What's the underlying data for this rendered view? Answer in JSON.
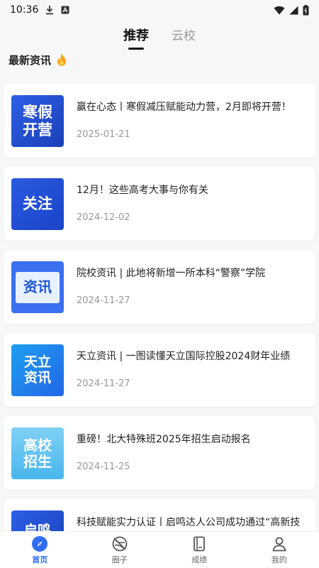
{
  "status": {
    "time": "10:36"
  },
  "tabs": [
    {
      "label": "推荐",
      "active": true
    },
    {
      "label": "云校",
      "active": false
    }
  ],
  "section": {
    "title": "最新资讯",
    "icon": "fire-icon"
  },
  "articles": [
    {
      "thumb_text": "寒假\n开营",
      "title": "赢在心态丨寒假减压赋能动力营，2月即将开营！",
      "date": "2025-01-21"
    },
    {
      "thumb_text": "关注",
      "title": "12月！这些高考大事与你有关",
      "date": "2024-12-02"
    },
    {
      "thumb_text": "资讯",
      "title": "院校资讯 | 此地将新增一所本科“警察”学院",
      "date": "2024-11-27"
    },
    {
      "thumb_text": "天立\n资讯",
      "title": "天立资讯 | 一图读懂天立国际控股2024财年业绩",
      "date": "2024-11-27"
    },
    {
      "thumb_text": "高校\n招生",
      "title": "重磅！北大特殊班2025年招生启动报名",
      "date": "2024-11-25"
    },
    {
      "thumb_text": "启鸣",
      "title": "科技赋能实力认证丨启鸣达人公司成功通过“高新技术企业”认定！",
      "date": ""
    }
  ],
  "nav": [
    {
      "label": "首页",
      "icon": "compass-icon",
      "active": true
    },
    {
      "label": "圈子",
      "icon": "circle-icon",
      "active": false
    },
    {
      "label": "成绩",
      "icon": "book-icon",
      "active": false
    },
    {
      "label": "我的",
      "icon": "person-icon",
      "active": false
    }
  ],
  "colors": {
    "accent": "#2f6cf6",
    "fire": "#f5a623"
  }
}
